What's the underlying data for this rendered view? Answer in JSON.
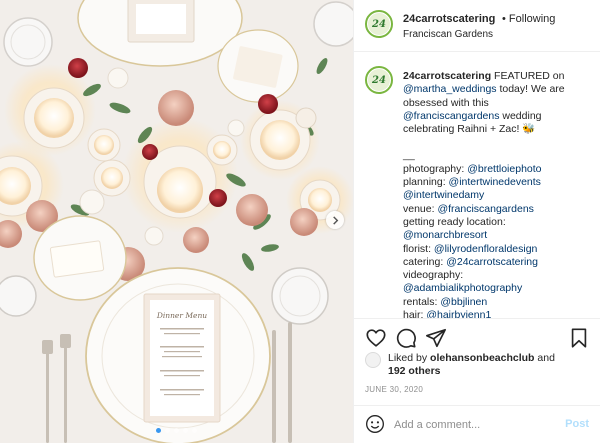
{
  "photo": {
    "menu_card": {
      "title": "Dinner Menu",
      "courses": [
        "first",
        "main",
        "dessert"
      ]
    },
    "carousel": {
      "count": 5,
      "active": 0
    }
  },
  "header": {
    "username": "24carrotscatering",
    "follow_status": "• Following",
    "location": "Franciscan Gardens",
    "avatar_text": "24"
  },
  "caption": {
    "username": "24carrotscatering",
    "lines": [
      {
        "type": "first",
        "text": " FEATURED on"
      },
      {
        "type": "mention",
        "text": "@martha_weddings",
        "after": " today! We are"
      },
      {
        "type": "text",
        "text": "obsessed with this"
      },
      {
        "type": "mention",
        "text": "@franciscangardens",
        "after": " wedding"
      },
      {
        "type": "text",
        "text": "celebrating Raihni + Zac! ",
        "emoji": "🐝"
      },
      {
        "type": "gap"
      },
      {
        "type": "text",
        "text": "__"
      },
      {
        "type": "label_mention",
        "label": "photography: ",
        "text": "@brettloiephoto"
      },
      {
        "type": "label_mention",
        "label": "planning: ",
        "text": "@intertwinedevents"
      },
      {
        "type": "mention",
        "text": "@intertwinedamy"
      },
      {
        "type": "label_mention",
        "label": "venue: ",
        "text": "@franciscangardens"
      },
      {
        "type": "text",
        "text": "getting ready location:"
      },
      {
        "type": "mention",
        "text": "@monarchbresort"
      },
      {
        "type": "label_mention",
        "label": "florist: ",
        "text": "@lilyrodenfloraldesign"
      },
      {
        "type": "label_mention",
        "label": "catering: ",
        "text": "@24carrotscatering"
      },
      {
        "type": "text",
        "text": "videography:"
      },
      {
        "type": "mention",
        "text": "@adambialikphotography"
      },
      {
        "type": "label_mention",
        "label": "rentals: ",
        "text": "@bbjlinen"
      },
      {
        "type": "label_mention",
        "label": "hair: ",
        "text": "@hairbyjenn1"
      }
    ]
  },
  "actions": {
    "icons": [
      "heart-icon",
      "comment-icon",
      "share-icon",
      "bookmark-icon"
    ]
  },
  "likes": {
    "prefix": "Liked by ",
    "user": "olehansonbeachclub",
    "middle": " and",
    "count": "192 others"
  },
  "date": "JUNE 30, 2020",
  "comment": {
    "placeholder": "Add a comment...",
    "post_label": "Post"
  },
  "colors": {
    "mention": "#00376b",
    "post_disabled": "#b2dffc",
    "carousel_active": "#3897f0",
    "avatar_ring": "#7ab640"
  }
}
